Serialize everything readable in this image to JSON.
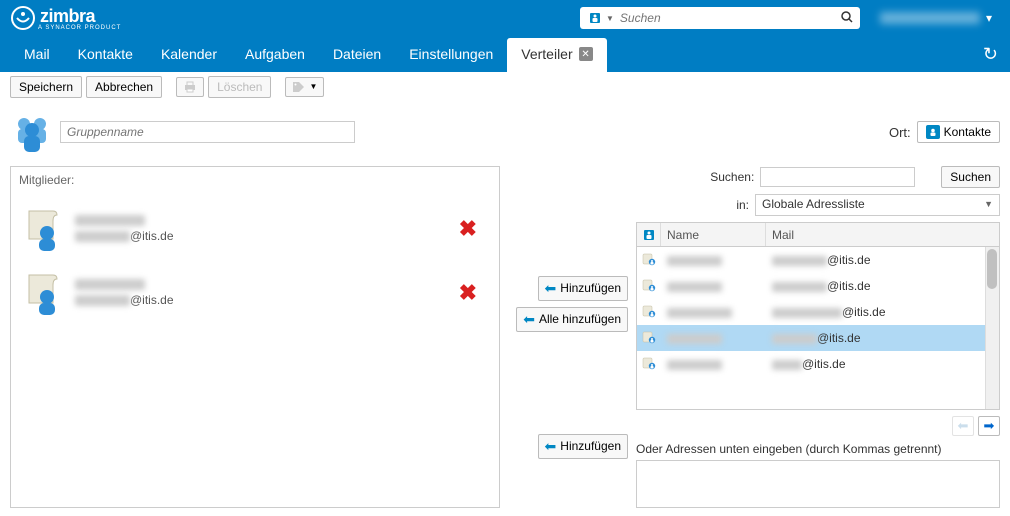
{
  "brand": {
    "name": "zimbra",
    "sub": "A SYNACOR PRODUCT"
  },
  "search": {
    "placeholder": "Suchen"
  },
  "tabs": {
    "mail": "Mail",
    "contacts": "Kontakte",
    "calendar": "Kalender",
    "tasks": "Aufgaben",
    "files": "Dateien",
    "settings": "Einstellungen",
    "active": "Verteiler"
  },
  "toolbar": {
    "save": "Speichern",
    "cancel": "Abbrechen",
    "delete": "Löschen"
  },
  "group": {
    "name_placeholder": "Gruppenname"
  },
  "location": {
    "label": "Ort:",
    "value": "Kontakte"
  },
  "members": {
    "title": "Mitglieder:",
    "items": [
      {
        "domain": "@itis.de"
      },
      {
        "domain": "@itis.de"
      }
    ]
  },
  "mid": {
    "add": "Hinzufügen",
    "add_all": "Alle hinzufügen",
    "add2": "Hinzufügen"
  },
  "right": {
    "search_label": "Suchen:",
    "search_btn": "Suchen",
    "in_label": "in:",
    "in_value": "Globale Adressliste",
    "col_name": "Name",
    "col_mail": "Mail",
    "rows": [
      {
        "domain": "@itis.de",
        "selected": false,
        "nwidth": 55,
        "mwidth": 55
      },
      {
        "domain": "@itis.de",
        "selected": false,
        "nwidth": 55,
        "mwidth": 55
      },
      {
        "domain": "@itis.de",
        "selected": false,
        "nwidth": 65,
        "mwidth": 70
      },
      {
        "domain": "@itis.de",
        "selected": true,
        "nwidth": 55,
        "mwidth": 45
      },
      {
        "domain": "@itis.de",
        "selected": false,
        "nwidth": 55,
        "mwidth": 30
      }
    ],
    "manual_label": "Oder Adressen unten eingeben (durch Kommas getrennt)"
  }
}
